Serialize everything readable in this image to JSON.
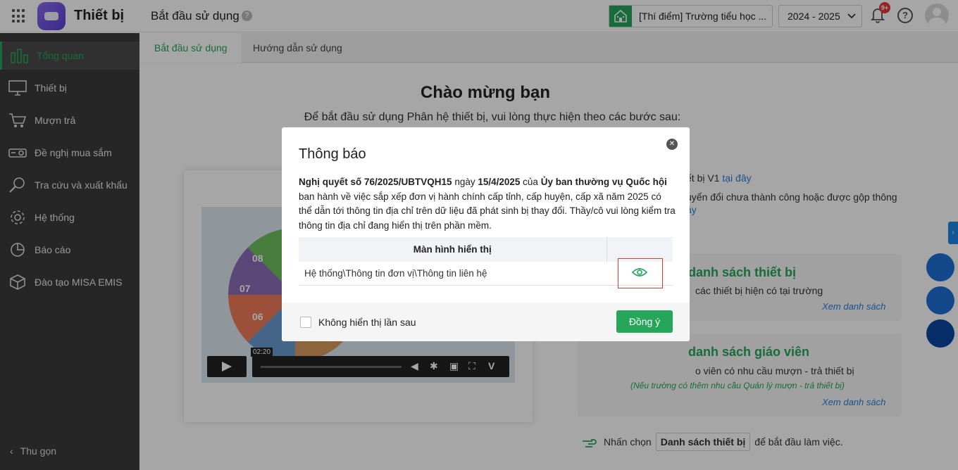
{
  "header": {
    "app_title": "Thiết bị",
    "page_title": "Bắt đầu sử dụng",
    "help_glyph": "?",
    "school": "[Thí điểm] Trường tiểu học ...",
    "year": "2024 - 2025",
    "notification_count": "9+"
  },
  "sidebar": {
    "items": [
      {
        "label": "Tổng quan"
      },
      {
        "label": "Thiết bị"
      },
      {
        "label": "Mượn trả"
      },
      {
        "label": "Đề nghị mua sắm"
      },
      {
        "label": "Tra cứu và xuất khẩu"
      },
      {
        "label": "Hệ thống"
      },
      {
        "label": "Báo cáo"
      },
      {
        "label": "Đào tạo MISA EMIS"
      }
    ],
    "collapse_label": "Thu gọn"
  },
  "tabs": [
    {
      "label": "Bắt đầu sử dụng"
    },
    {
      "label": "Hướng dẫn sử dụng"
    }
  ],
  "content": {
    "welcome_title": "Chào mừng bạn",
    "welcome_sub": "Để bắt đầu sử dụng Phân hệ thiết bị, vui lòng thực hiện theo các bước sau:",
    "video": {
      "time": "02:20",
      "wheel_numbers": [
        "08",
        "07",
        "06"
      ]
    },
    "right_line1_visible": "ết bị V1",
    "right_line1_link": "tại đây",
    "right_line2_visible": "uyển đổi chưa thành công hoặc được gộp thông",
    "right_line3_link": "ây",
    "card1": {
      "title_visible": "danh sách thiết bị",
      "desc_visible": "các thiết bị hiện có tại trường",
      "link": "Xem danh sách"
    },
    "card2": {
      "title_visible": "danh sách giáo viên",
      "desc_visible": "o viên có nhu cầu mượn - trả thiết bị",
      "note": "(Nếu trường có thêm nhu cầu Quản lý mượn - trả thiết bị)",
      "link": "Xem danh sách"
    },
    "hint_prefix": "Nhấn chọn",
    "hint_button": "Danh sách thiết bị",
    "hint_suffix": "để bắt đầu làm việc."
  },
  "modal": {
    "title": "Thông báo",
    "close_glyph": "✕",
    "body": {
      "p1_bold": "Nghị quyết số 76/2025/UBTVQH15",
      "p2": " ngày ",
      "p3_bold": "15/4/2025",
      "p4": " của ",
      "p5_bold": "Ủy ban thường vụ Quốc hội",
      "p6": " ban hành về việc sắp xếp đơn vị hành chính cấp tỉnh, cấp huyện, cấp xã năm 2025 có thể dẫn tới thông tin địa chỉ trên dữ liệu đã phát sinh bị thay đổi. Thầy/cô vui lòng kiểm tra thông tin địa chỉ đang hiển thị trên phần mềm."
    },
    "table": {
      "header": "Màn hình hiển thị",
      "rows": [
        {
          "path": "Hệ thống\\Thông tin đơn vị\\Thông tin liên hệ"
        }
      ]
    },
    "checkbox_label": "Không hiển thị lần sau",
    "ok_button": "Đồng ý"
  },
  "colors": {
    "accent": "#26a65b",
    "link": "#2a7fd4",
    "sidebar_bg": "#3b3b3b",
    "highlight": "#e53935"
  }
}
